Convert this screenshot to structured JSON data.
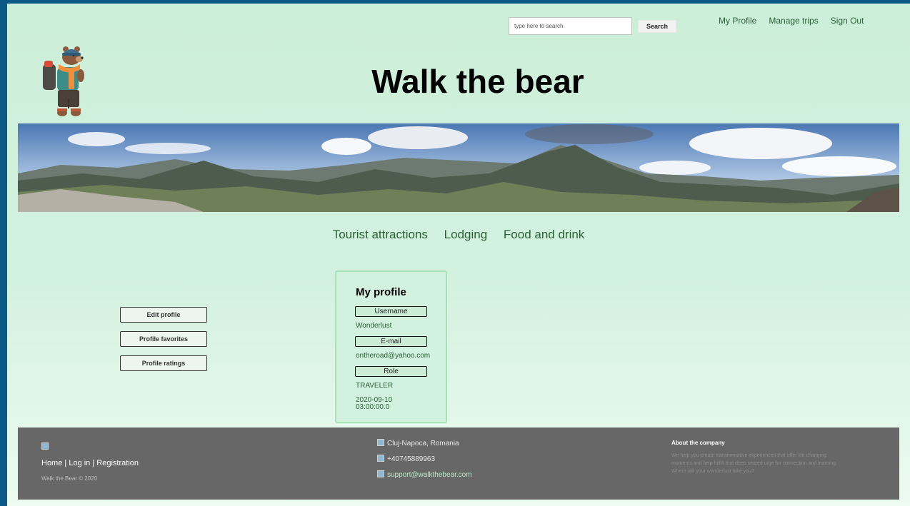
{
  "header": {
    "search": {
      "placeholder": "type here to search",
      "button_label": "Search"
    },
    "nav": {
      "my_profile": "My Profile",
      "manage_trips": "Manage trips",
      "sign_out": "Sign Out"
    },
    "title": "Walk the bear"
  },
  "main_nav": {
    "tourist": "Tourist attractions",
    "lodging": "Lodging",
    "food": "Food and drink"
  },
  "sidebar": {
    "edit": "Edit profile",
    "favorites": "Profile favorites",
    "ratings": "Profile ratings"
  },
  "profile_card": {
    "title": "My profile",
    "username_label": "Username",
    "username": "Wonderlust",
    "email_label": "E-mail",
    "email": "ontheroad@yahoo.com",
    "role_label": "Role",
    "role": "TRAVELER",
    "date_line1": "2020-09-10",
    "date_line2": "03:00:00.0"
  },
  "footer": {
    "home": "Home",
    "login": "Log in",
    "registration": "Registration",
    "separator": "|",
    "copyright": "Walk the Bear © 2020",
    "location": "Cluj-Napoca, Romania",
    "phone": "+40745889963",
    "email": "support@walkthebear.com",
    "about_title": "About the company",
    "about_text": "We help you create transformative experiences that offer life changing moments and help fulfill that deep seated urge for connection and learning. Where will your wanderlust take you?"
  },
  "colors": {
    "nav_green": "#2a5e35",
    "page_bg": "#ccefd9",
    "footer_bg": "#676767",
    "outer_border": "#0b5a86"
  },
  "icons": [
    "bear-hiker-logo",
    "broken-image-icon",
    "location-icon",
    "phone-icon",
    "email-icon"
  ]
}
